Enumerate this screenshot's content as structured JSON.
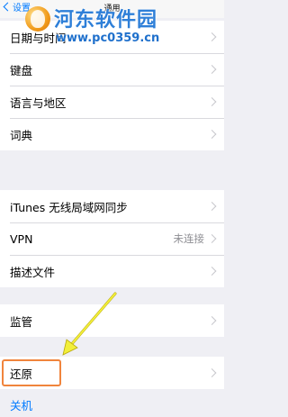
{
  "nav": {
    "back_label": "设置",
    "title": "通用"
  },
  "watermark": {
    "title": "河东软件园",
    "url": "www.pc0359.cn"
  },
  "group1": [
    {
      "label": "日期与时间"
    },
    {
      "label": "键盘"
    },
    {
      "label": "语言与地区"
    },
    {
      "label": "词典"
    }
  ],
  "group2": [
    {
      "label": "iTunes 无线局域网同步"
    },
    {
      "label": "VPN",
      "detail": "未连接"
    },
    {
      "label": "描述文件"
    }
  ],
  "group3": [
    {
      "label": "监管"
    }
  ],
  "group4": [
    {
      "label": "还原"
    }
  ],
  "shutdown_label": "关机",
  "colors": {
    "background": "#efeff4",
    "accent": "#007aff",
    "highlight": "#f0843c",
    "arrow": "#f2ef3a"
  }
}
